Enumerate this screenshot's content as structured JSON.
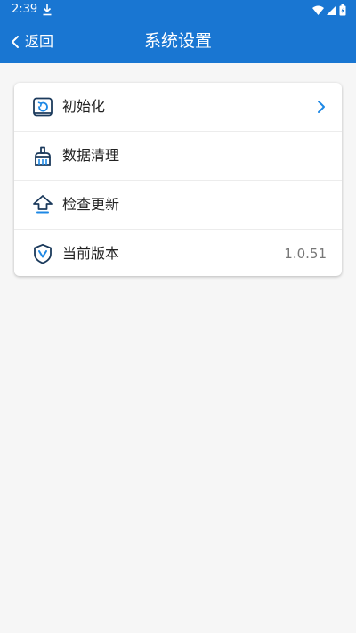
{
  "status_bar": {
    "time": "2:39"
  },
  "app_bar": {
    "back_label": "返回",
    "title": "系统设置"
  },
  "settings": {
    "items": [
      {
        "label": "初始化",
        "icon": "restore-icon",
        "trailing": "chevron"
      },
      {
        "label": "数据清理",
        "icon": "brush-icon"
      },
      {
        "label": "检查更新",
        "icon": "upload-arrow-icon"
      },
      {
        "label": "当前版本",
        "icon": "shield-v-icon",
        "value": "1.0.51"
      }
    ]
  },
  "colors": {
    "primary": "#1976d2",
    "icon_dark": "#1b3a5c",
    "icon_accent": "#1e88e5",
    "background": "#f6f6f6",
    "card": "#ffffff"
  }
}
